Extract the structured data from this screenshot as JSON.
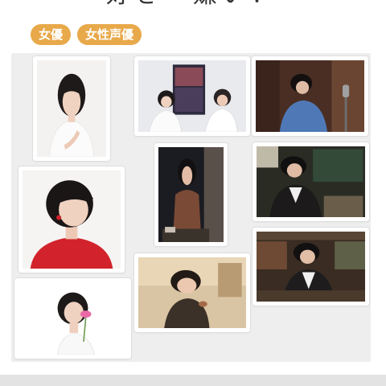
{
  "header": {
    "title": "好き・嫌い！"
  },
  "tags": [
    {
      "label": "女優"
    },
    {
      "label": "女性声優"
    }
  ],
  "colors": {
    "tag_bg": "#e8a94a",
    "board_bg": "#eeeeee"
  }
}
